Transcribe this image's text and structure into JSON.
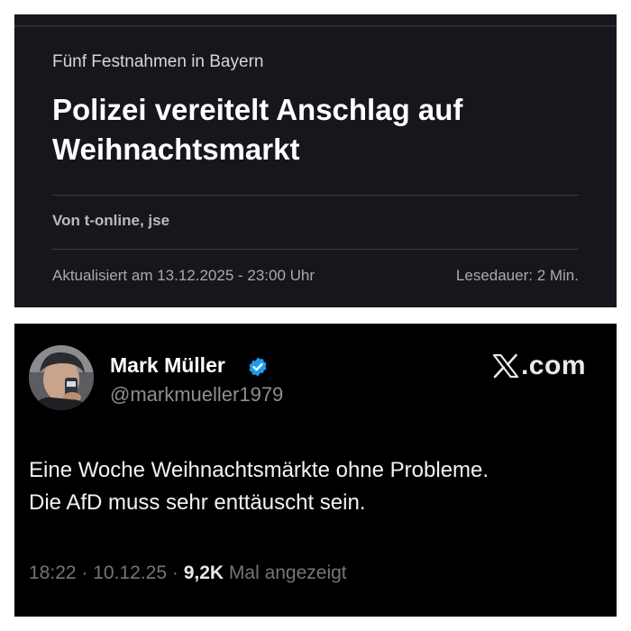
{
  "article": {
    "kicker": "Fünf Festnahmen in Bayern",
    "headline_line1": "Polizei vereitelt Anschlag auf",
    "headline_line2": "Weihnachtsmarkt",
    "byline": "Von t-online, jse",
    "updated": "Aktualisiert am 13.12.2025 - 23:00 Uhr",
    "read_time": "Lesedauer: 2 Min.",
    "colors": {
      "background": "#16171c",
      "headline": "#ffffff",
      "secondary": "#a9aab1"
    }
  },
  "post": {
    "author_name": "Mark Müller",
    "handle": "@markmueller1979",
    "verified_icon": "verified-badge-icon",
    "source_label": ".com",
    "source_icon": "x-logo-icon",
    "text_line1": "Eine Woche Weihnachtsmärkte ohne Probleme.",
    "text_line2": "Die AfD muss sehr enttäuscht sein.",
    "time": "18:22",
    "separator": "·",
    "date": "10.12.25",
    "views_count": "9,2K",
    "views_label": "Mal angezeigt",
    "colors": {
      "background": "#000000",
      "text": "#e7e9ea",
      "muted": "#71767b",
      "verified": "#1d9bf0"
    }
  }
}
